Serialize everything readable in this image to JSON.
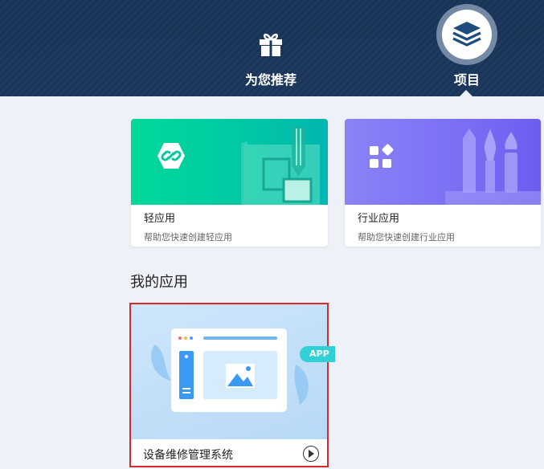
{
  "nav": {
    "recommend": {
      "label": "为您推荐",
      "icon": "gift-icon"
    },
    "project": {
      "label": "项目",
      "icon": "layers-icon",
      "active": true
    }
  },
  "cards": [
    {
      "title": "轻应用",
      "desc": "帮助您快速创建轻应用",
      "icon": "link-icon",
      "color": "#00d99a"
    },
    {
      "title": "行业应用",
      "desc": "帮助您快速创建行业应用",
      "icon": "apps-grid-icon",
      "color": "#7a6ff4"
    }
  ],
  "my_apps": {
    "section_title": "我的应用",
    "items": [
      {
        "name": "设备维修管理系统",
        "badge": "APP",
        "icon": "play-icon"
      }
    ]
  },
  "colors": {
    "header": "#1a3558",
    "page_bg": "#eef1f7",
    "selected_border": "#d62b2b",
    "badge": "#2fd1d6"
  }
}
